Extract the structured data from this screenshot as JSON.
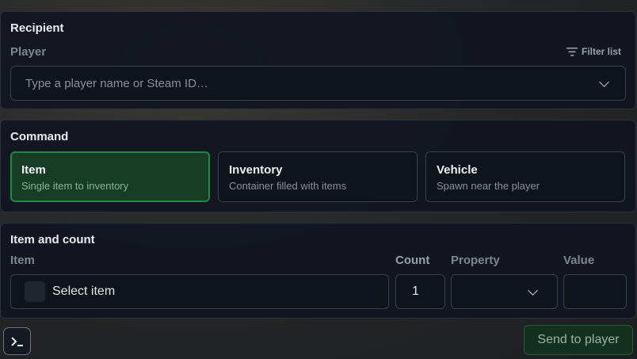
{
  "recipient": {
    "title": "Recipient",
    "player_label": "Player",
    "filter_label": "Filter list",
    "player_placeholder": "Type a player name or Steam ID…"
  },
  "command": {
    "title": "Command",
    "options": [
      {
        "title": "Item",
        "desc": "Single item to inventory",
        "selected": true
      },
      {
        "title": "Inventory",
        "desc": "Container filled with items",
        "selected": false
      },
      {
        "title": "Vehicle",
        "desc": "Spawn near the player",
        "selected": false
      }
    ]
  },
  "item_count": {
    "title": "Item and count",
    "item_label": "Item",
    "count_label": "Count",
    "property_label": "Property",
    "value_label": "Value",
    "item_select_text": "Select item",
    "count_value": "1",
    "property_value": "",
    "value_value": ""
  },
  "footer": {
    "send_label": "Send to player",
    "terminal_icon": "terminal-icon"
  },
  "colors": {
    "accent_green": "#1f8a44",
    "panel_bg": "#12161f",
    "border": "#3a404c"
  }
}
